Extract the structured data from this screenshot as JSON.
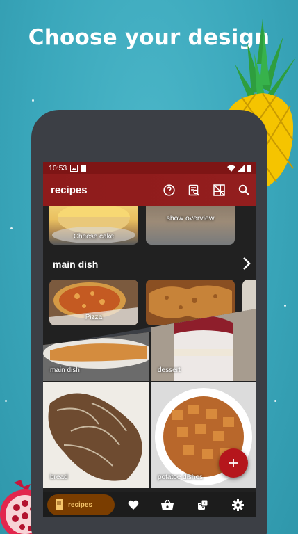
{
  "headline": "Choose your design",
  "status_bar": {
    "time": "10:53"
  },
  "app_bar": {
    "title": "recipes",
    "actions": [
      "help-icon",
      "search-list-icon",
      "grid-icon",
      "search-icon"
    ]
  },
  "top_row": [
    {
      "label": "Cheese cake"
    },
    {
      "label": "show overview"
    }
  ],
  "section": {
    "title": "main dish"
  },
  "main_dish_row": [
    {
      "label": "Pizza"
    }
  ],
  "category_tiles": [
    {
      "label": "main dish"
    },
    {
      "label": "dessert"
    },
    {
      "label": "bread"
    },
    {
      "label": "potatoe dishes"
    }
  ],
  "bottom_nav": {
    "active_label": "recipes",
    "items": [
      "recipes-icon",
      "heart-icon",
      "basket-icon",
      "dice-icon",
      "gear-icon"
    ]
  },
  "colors": {
    "app_bar": "#8e1b1b",
    "fab": "#b5161c",
    "nav_active": "#7a3d00",
    "background": "#3aa7bb"
  }
}
